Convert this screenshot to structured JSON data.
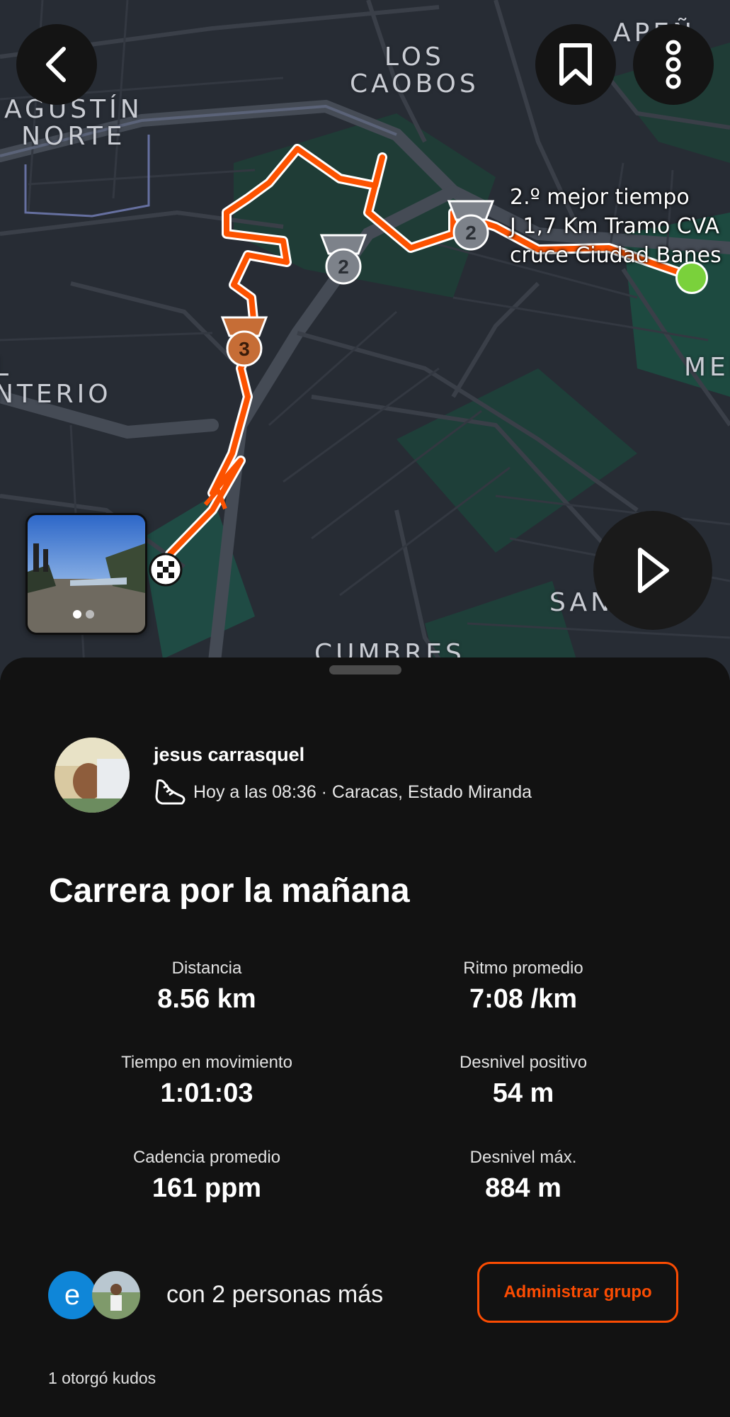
{
  "map": {
    "labels": {
      "los_caobos": "LOS\nCAOBOS",
      "agustin_norte": "AGUSTÍN\nNORTE",
      "cumbres": "CUMBRES",
      "san": "SAN",
      "cementerio": "L\nNTERIO",
      "mer": "MER",
      "apen": "APEÑ"
    },
    "segment_tooltip": [
      "2.º mejor tiempo",
      "J 1,7 Km Tramo CVA",
      "cruce Ciudad Banes"
    ],
    "medals": [
      {
        "rank": "2",
        "color": "#8a8f96"
      },
      {
        "rank": "2",
        "color": "#8a8f96"
      },
      {
        "rank": "3",
        "color": "#c8703a"
      }
    ],
    "route_color": "#fc5200",
    "start_color": "#7ad13b",
    "icons": {
      "back": "chevron-left-icon",
      "bookmark": "bookmark-icon",
      "more": "more-vertical-icon",
      "play": "play-icon",
      "finish": "checkered-flag-icon"
    }
  },
  "athlete": {
    "name": "jesus carrasquel",
    "meta": "Hoy a las 08:36 · Caracas, Estado Miranda",
    "activity_icon": "running-shoe-icon"
  },
  "activity": {
    "title": "Carrera por la mañana",
    "stats": [
      {
        "label": "Distancia",
        "value": "8.56 km"
      },
      {
        "label": "Ritmo promedio",
        "value": "7:08 /km"
      },
      {
        "label": "Tiempo en movimiento",
        "value": "1:01:03"
      },
      {
        "label": "Desnivel positivo",
        "value": "54 m"
      },
      {
        "label": "Cadencia promedio",
        "value": "161 ppm"
      },
      {
        "label": "Desnivel máx.",
        "value": "884 m"
      }
    ]
  },
  "group": {
    "avatar_letter": "e",
    "text": "con 2 personas más",
    "button": "Administrar grupo",
    "accent": "#fc4c02"
  },
  "kudos": "1 otorgó kudos"
}
